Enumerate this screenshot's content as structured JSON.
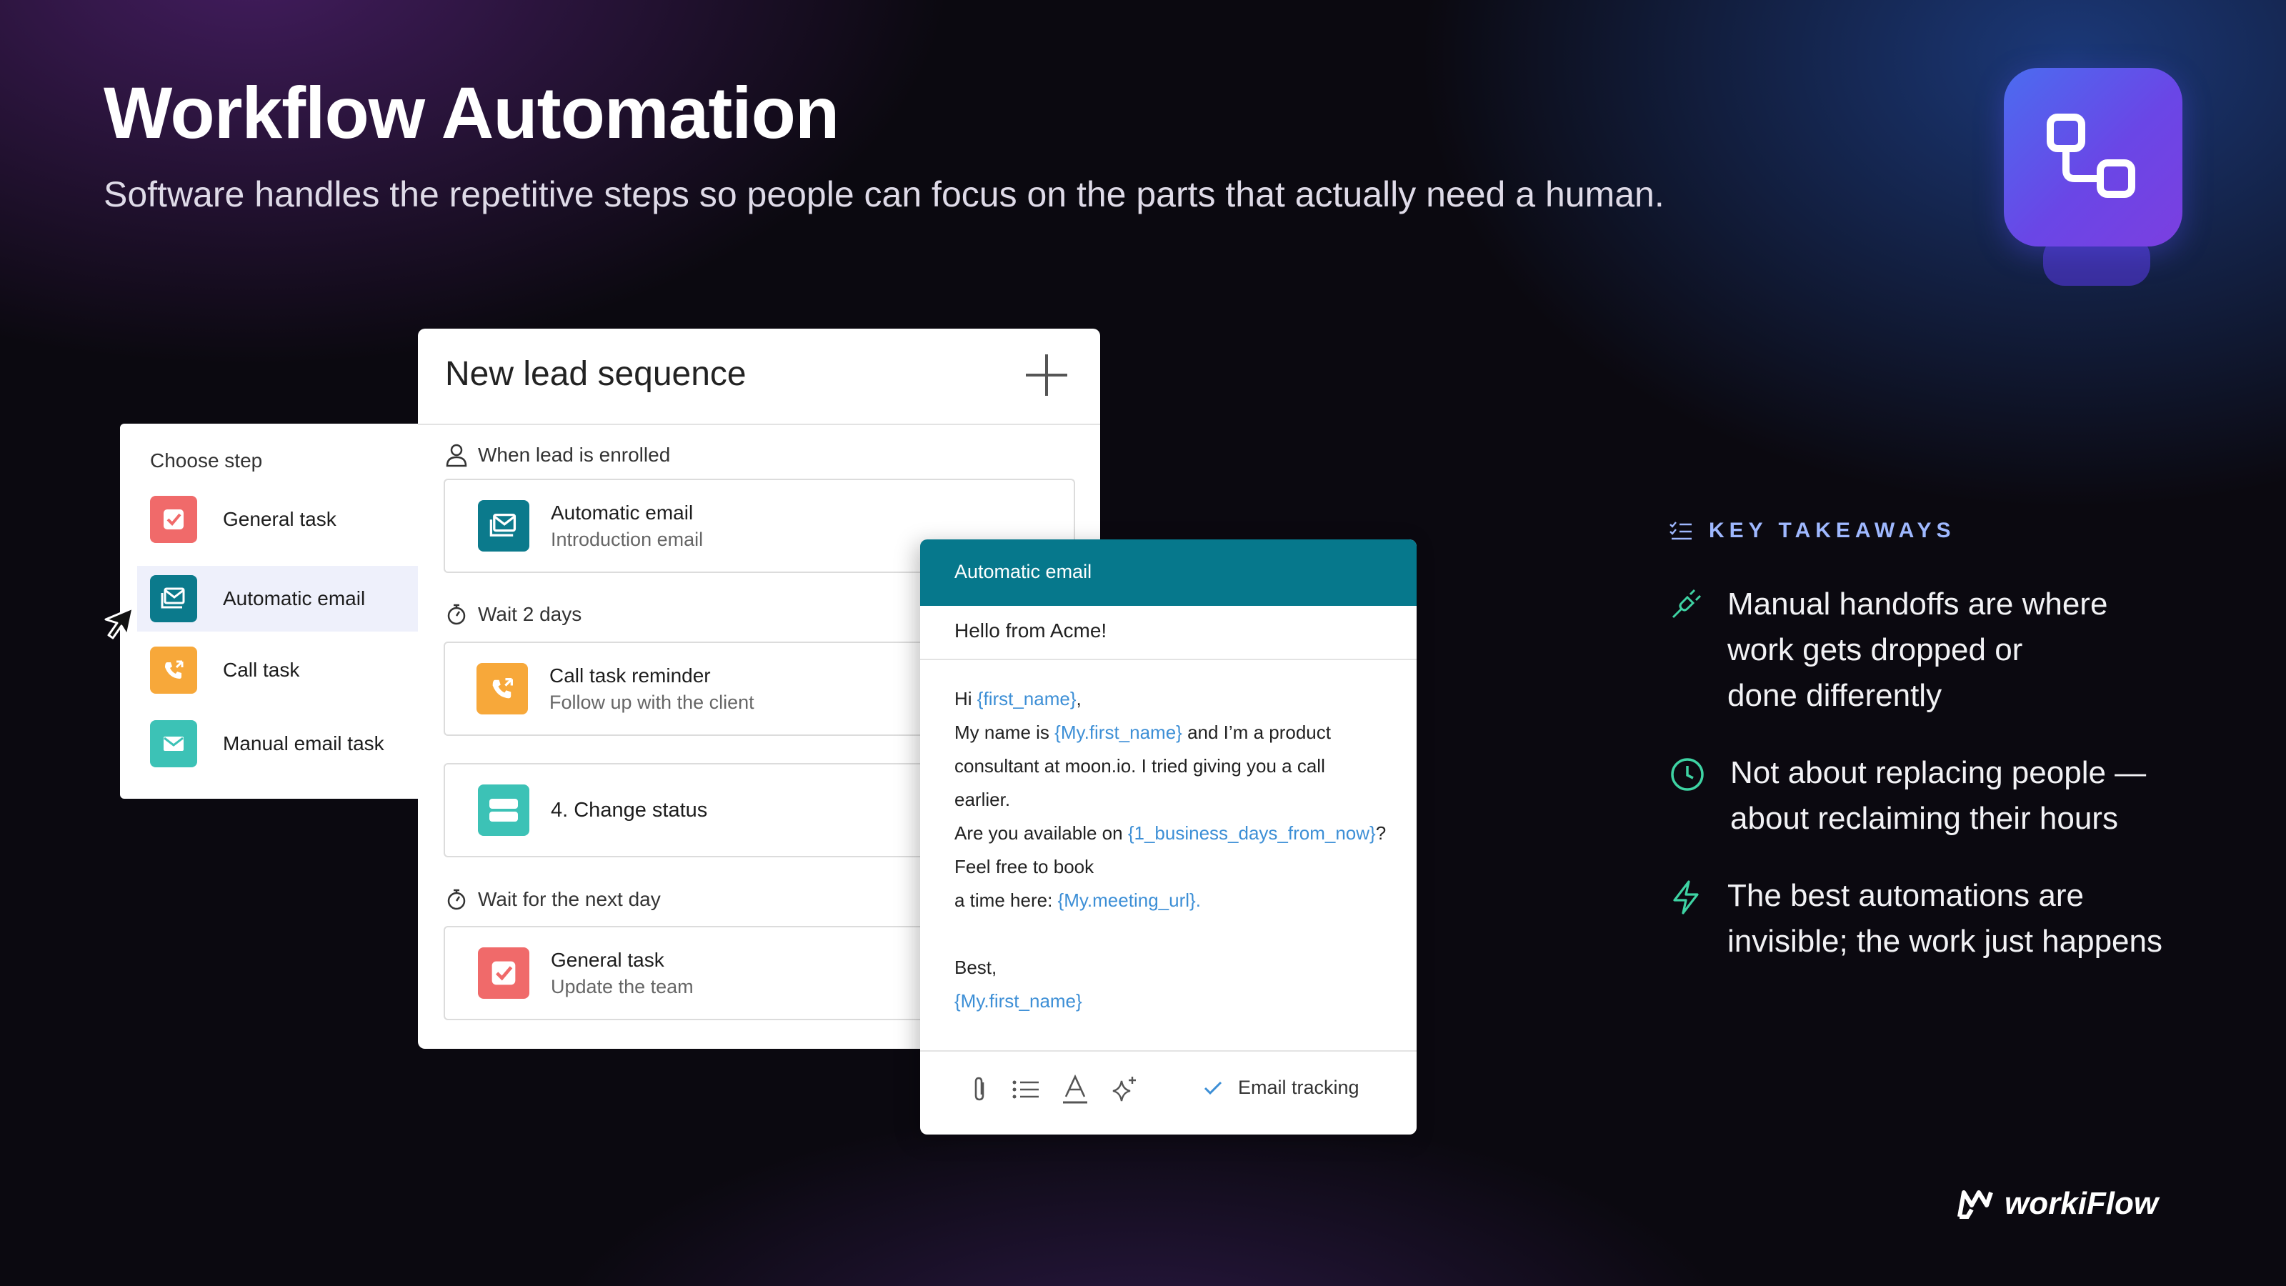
{
  "header": {
    "title": "Workflow Automation",
    "subtitle": "Software handles the repetitive steps so people can focus on the parts that actually need a human."
  },
  "chooser": {
    "title": "Choose step",
    "items": [
      {
        "label": "General task",
        "icon": "checkbox-icon",
        "color": "#f06a6a"
      },
      {
        "label": "Automatic email",
        "icon": "email-stack-icon",
        "color": "#0b7a8c"
      },
      {
        "label": "Call task",
        "icon": "phone-icon",
        "color": "#f7a83a"
      },
      {
        "label": "Manual email task",
        "icon": "envelope-icon",
        "color": "#3cc2b6"
      }
    ]
  },
  "sequence": {
    "title": "New lead sequence",
    "trigger_label": "When lead is enrolled",
    "steps": [
      {
        "title": "Automatic email",
        "subtitle": "Introduction email"
      },
      {
        "wait": "Wait 2 days"
      },
      {
        "title": "Call task reminder",
        "subtitle": "Follow up with the client"
      },
      {
        "title": "4. Change status"
      },
      {
        "wait": "Wait for the next day"
      },
      {
        "title": "General task",
        "subtitle": "Update the team"
      }
    ]
  },
  "email": {
    "header": "Automatic email",
    "subject": "Hello from Acme!",
    "body": {
      "greeting": "Hi ",
      "var_first_name": "{first_name}",
      "comma": ",",
      "line2_a": "My name is ",
      "var_my_first_name": "{My.first_name}",
      "line2_b": " and I’m a product",
      "line3": "consultant at moon.io. I tried giving you a call",
      "line4": "earlier.",
      "line5_a": "Are you available on ",
      "var_days": "{1_business_days_from_now}",
      "line5_b": "?",
      "line6": "Feel free to book",
      "line7_a": "a time here: ",
      "var_meeting": "{My.meeting_url}.",
      "signoff": "Best,",
      "var_signature": "{My.first_name}"
    },
    "tracking_label": "Email tracking"
  },
  "takeaways": {
    "heading": "KEY TAKEAWAYS",
    "items": [
      {
        "icon": "plug-icon",
        "line1": "Manual handoffs are where",
        "line2": "work gets dropped or",
        "line3": "done differently"
      },
      {
        "icon": "clock-icon",
        "line1": "Not about replacing people —",
        "line2": "about reclaiming their hours"
      },
      {
        "icon": "lightning-icon",
        "line1": "The best automations are",
        "line2": "invisible; the work just happens"
      }
    ]
  },
  "brand": {
    "name": "workiFlow"
  },
  "colors": {
    "teal": "#06788c",
    "accent_green": "#3ed3a3",
    "takeaway_heading": "#9fb8ff",
    "variable": "#3d8fd6"
  }
}
